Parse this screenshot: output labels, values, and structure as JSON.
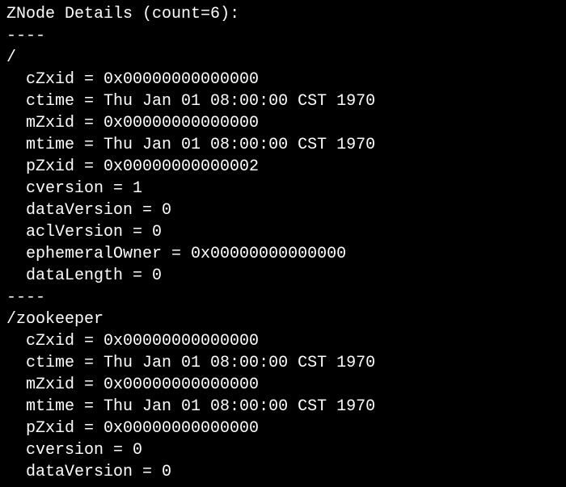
{
  "header": {
    "title_prefix": "ZNode Details (count=",
    "count": "6",
    "title_suffix": "):"
  },
  "separator": "----",
  "nodes": [
    {
      "path": "/",
      "props": [
        {
          "key": "cZxid",
          "value": "0x00000000000000"
        },
        {
          "key": "ctime",
          "value": "Thu Jan 01 08:00:00 CST 1970"
        },
        {
          "key": "mZxid",
          "value": "0x00000000000000"
        },
        {
          "key": "mtime",
          "value": "Thu Jan 01 08:00:00 CST 1970"
        },
        {
          "key": "pZxid",
          "value": "0x00000000000002"
        },
        {
          "key": "cversion",
          "value": "1"
        },
        {
          "key": "dataVersion",
          "value": "0"
        },
        {
          "key": "aclVersion",
          "value": "0"
        },
        {
          "key": "ephemeralOwner",
          "value": "0x00000000000000"
        },
        {
          "key": "dataLength",
          "value": "0"
        }
      ]
    },
    {
      "path": "/zookeeper",
      "props": [
        {
          "key": "cZxid",
          "value": "0x00000000000000"
        },
        {
          "key": "ctime",
          "value": "Thu Jan 01 08:00:00 CST 1970"
        },
        {
          "key": "mZxid",
          "value": "0x00000000000000"
        },
        {
          "key": "mtime",
          "value": "Thu Jan 01 08:00:00 CST 1970"
        },
        {
          "key": "pZxid",
          "value": "0x00000000000000"
        },
        {
          "key": "cversion",
          "value": "0"
        },
        {
          "key": "dataVersion",
          "value": "0"
        }
      ]
    }
  ]
}
